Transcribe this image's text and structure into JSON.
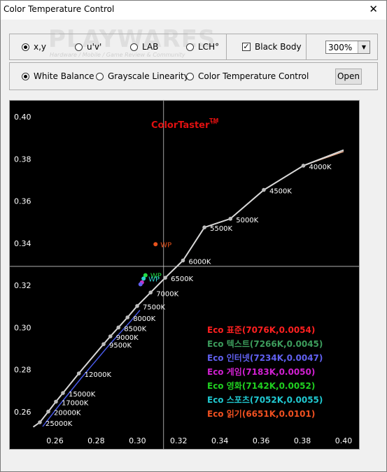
{
  "window": {
    "title": "Color Temperature Control",
    "close_glyph": "✕"
  },
  "watermark": {
    "main": "PLAYWARES",
    "sub": "Hardware / Mobile / Game Review & Community"
  },
  "colorspace": {
    "options": [
      {
        "label": "x,y",
        "checked": true
      },
      {
        "label": "u'v'",
        "checked": false
      },
      {
        "label": "LAB",
        "checked": false
      },
      {
        "label": "LCH°",
        "checked": false
      }
    ]
  },
  "black_body": {
    "label": "Black Body",
    "checked": true
  },
  "zoom": {
    "value": "300%"
  },
  "mode": {
    "options": [
      {
        "label": "White Balance",
        "checked": true
      },
      {
        "label": "Grayscale Linearity",
        "checked": false
      },
      {
        "label": "Color Temperature Control",
        "checked": false
      }
    ]
  },
  "open_button": {
    "label": "Open"
  },
  "chart_data": {
    "type": "scatter",
    "title": "ColorTaster™",
    "xlim": [
      0.25,
      0.4
    ],
    "ylim": [
      0.25,
      0.4
    ],
    "x_ticks": [
      "0.26",
      "0.28",
      "0.30",
      "0.32",
      "0.34",
      "0.36",
      "0.38",
      "0.40"
    ],
    "y_ticks": [
      "0.40",
      "0.38",
      "0.36",
      "0.34",
      "0.32",
      "0.30",
      "0.28",
      "0.26"
    ],
    "crosshair": {
      "x": 0.3127,
      "y": 0.329
    },
    "blackbody_points": [
      {
        "label": "4000K",
        "x": 0.3805,
        "y": 0.3768
      },
      {
        "label": "4500K",
        "x": 0.3613,
        "y": 0.3653
      },
      {
        "label": "5000K",
        "x": 0.3451,
        "y": 0.3516
      },
      {
        "label": "5500K",
        "x": 0.3325,
        "y": 0.3475
      },
      {
        "label": "6000K",
        "x": 0.3221,
        "y": 0.3318
      },
      {
        "label": "6500K",
        "x": 0.3135,
        "y": 0.3236
      },
      {
        "label": "7000K",
        "x": 0.3064,
        "y": 0.3166
      },
      {
        "label": "7500K",
        "x": 0.2999,
        "y": 0.3102
      },
      {
        "label": "8000K",
        "x": 0.2952,
        "y": 0.3048
      },
      {
        "label": "8500K",
        "x": 0.2908,
        "y": 0.3
      },
      {
        "label": "9000K",
        "x": 0.2869,
        "y": 0.2958
      },
      {
        "label": "9500K",
        "x": 0.2836,
        "y": 0.2921
      },
      {
        "label": "12000K",
        "x": 0.2716,
        "y": 0.2782
      },
      {
        "label": "15000K",
        "x": 0.2639,
        "y": 0.2689
      },
      {
        "label": "17000K",
        "x": 0.2605,
        "y": 0.2648
      },
      {
        "label": "20000K",
        "x": 0.2568,
        "y": 0.2601
      },
      {
        "label": "25000K",
        "x": 0.2527,
        "y": 0.255
      }
    ],
    "wp_points": [
      {
        "label": "WP",
        "x": 0.3088,
        "y": 0.3395,
        "color": "#e8521c"
      },
      {
        "label": "WP",
        "x": 0.3039,
        "y": 0.3248,
        "color": "#22dd44"
      },
      {
        "label": "WP",
        "x": 0.303,
        "y": 0.3232,
        "color": "#2ed0d0"
      },
      {
        "label": "",
        "x": 0.3022,
        "y": 0.3214,
        "color": "#c832c8"
      },
      {
        "label": "",
        "x": 0.3015,
        "y": 0.3205,
        "color": "#6060f0"
      }
    ],
    "legend": [
      {
        "prefix": "Eco",
        "name": "표준",
        "value": "(7076K,0.0054)",
        "color": "#ff2020"
      },
      {
        "prefix": "Eco",
        "name": "텍스트",
        "value": "(7266K,0.0045)",
        "color": "#3c9c5c"
      },
      {
        "prefix": "Eco",
        "name": "인터넷",
        "value": "(7234K,0.0047)",
        "color": "#6060f0"
      },
      {
        "prefix": "Eco",
        "name": "게임",
        "value": "(7183K,0.0050)",
        "color": "#d020d0"
      },
      {
        "prefix": "Eco",
        "name": "영화",
        "value": "(7142K,0.0052)",
        "color": "#20d020"
      },
      {
        "prefix": "Eco",
        "name": "스포츠",
        "value": "(7052K,0.0055)",
        "color": "#20c8d0"
      },
      {
        "prefix": "Eco",
        "name": "읽기",
        "value": "(6651K,0.0101)",
        "color": "#f05020"
      }
    ],
    "colors": {
      "background": "#000000",
      "axis_text": "#ffffff",
      "curve": "#d8d8d8",
      "title": "#e01010",
      "crosshair": "#c8c8c8",
      "trace_blue": "#4a5cf0",
      "trace_peach": "#f0b090"
    }
  }
}
